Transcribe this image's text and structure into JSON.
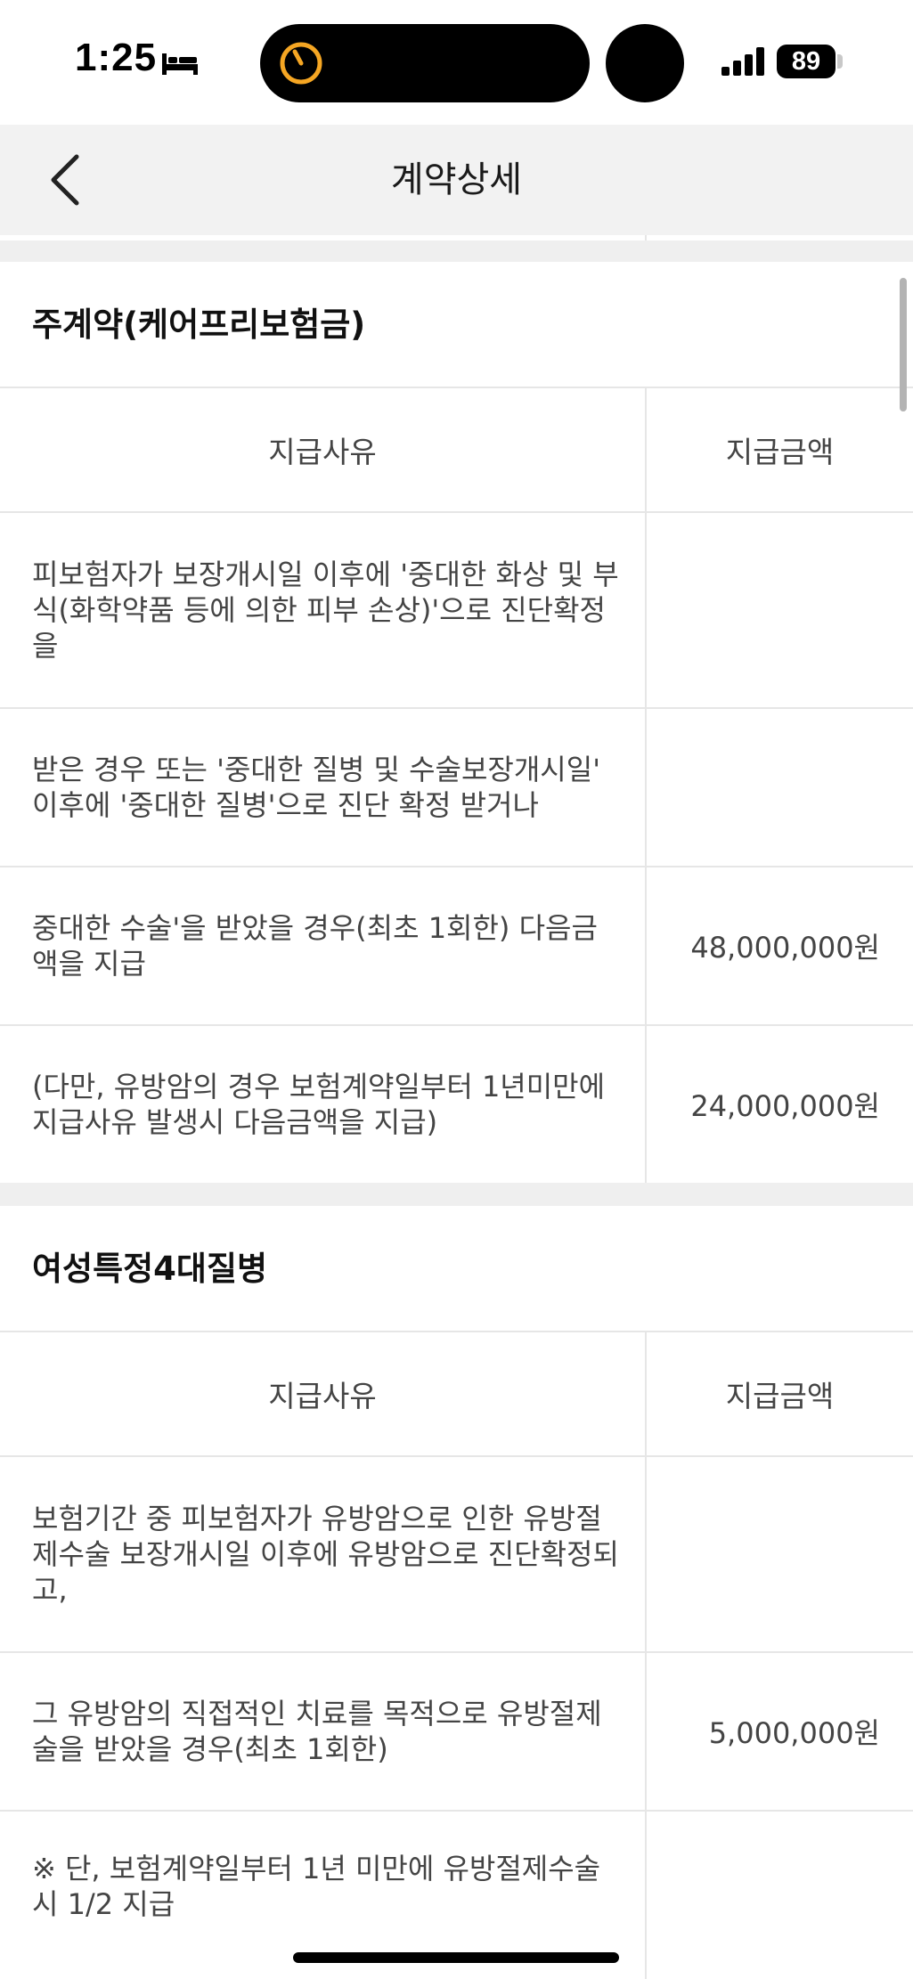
{
  "status_bar": {
    "time": "1:25",
    "battery": "89",
    "icons": [
      "bed-icon",
      "timer-icon",
      "signal-icon",
      "battery-icon"
    ]
  },
  "header": {
    "title": "계약상세",
    "back_icon": "chevron-left-icon"
  },
  "sections": [
    {
      "title": "주계약(케어프리보험금)",
      "col_reason": "지급사유",
      "col_amount": "지급금액",
      "rows": [
        {
          "reason": "피보험자가 보장개시일 이후에 '중대한 화상 및 부식(화학약품 등에 의한 피부 손상)'으로 진단확정을",
          "amount": ""
        },
        {
          "reason": "받은 경우 또는 '중대한 질병 및 수술보장개시일' 이후에 '중대한 질병'으로 진단 확정 받거나",
          "amount": ""
        },
        {
          "reason": "중대한 수술'을 받았을 경우(최초 1회한) 다음금액을 지급",
          "amount": "48,000,000원"
        },
        {
          "reason": "(다만, 유방암의 경우 보험계약일부터 1년미만에 지급사유 발생시 다음금액을 지급)",
          "amount": "24,000,000원"
        }
      ]
    },
    {
      "title": "여성특정4대질병",
      "col_reason": "지급사유",
      "col_amount": "지급금액",
      "rows": [
        {
          "reason": "보험기간 중 피보험자가 유방암으로 인한 유방절제수술 보장개시일 이후에 유방암으로 진단확정되고,",
          "amount": ""
        },
        {
          "reason": "그 유방암의 직접적인 치료를 목적으로 유방절제술을 받았을 경우(최초 1회한)",
          "amount": "5,000,000원"
        },
        {
          "reason": "※ 단, 보험계약일부터 1년 미만에 유방절제수술시 1/2 지급",
          "amount": ""
        }
      ]
    }
  ]
}
